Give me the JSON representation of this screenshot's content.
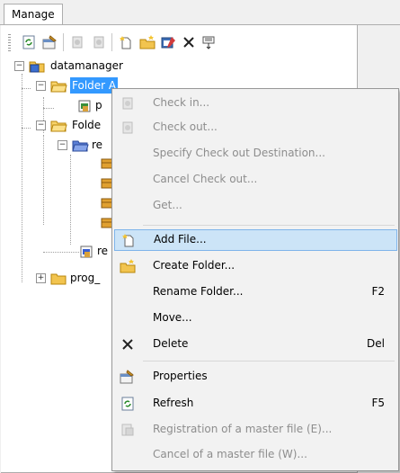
{
  "tab": {
    "label": "Manage"
  },
  "toolbar": {
    "buttons": [
      {
        "name": "refresh-icon"
      },
      {
        "name": "properties-icon"
      },
      {
        "name": "check-in-icon"
      },
      {
        "name": "check-out-icon"
      },
      {
        "name": "add-file-icon"
      },
      {
        "name": "create-folder-icon"
      },
      {
        "name": "rename-icon"
      },
      {
        "name": "delete-icon"
      },
      {
        "name": "settings-icon"
      }
    ]
  },
  "tree": {
    "root": "datamanager",
    "folder_a": "Folder A",
    "folder_a_child": "p",
    "folder_b": "Folde",
    "folder_b_child": "re",
    "folder_b_child2": "re",
    "prog": "prog_"
  },
  "menu": {
    "items": [
      {
        "label": "Check in...",
        "key": "",
        "enabled": false,
        "icon": "check-in-icon"
      },
      {
        "label": "Check out...",
        "key": "",
        "enabled": false,
        "icon": "check-out-icon"
      },
      {
        "label": "Specify Check out Destination...",
        "key": "",
        "enabled": false,
        "icon": ""
      },
      {
        "label": "Cancel Check out...",
        "key": "",
        "enabled": false,
        "icon": ""
      },
      {
        "label": "Get...",
        "key": "",
        "enabled": false,
        "icon": ""
      },
      {
        "label": "Add File...",
        "key": "",
        "enabled": true,
        "icon": "add-file-icon",
        "highlighted": true
      },
      {
        "label": "Create Folder...",
        "key": "",
        "enabled": true,
        "icon": "create-folder-icon"
      },
      {
        "label": "Rename Folder...",
        "key": "F2",
        "enabled": true,
        "icon": ""
      },
      {
        "label": "Move...",
        "key": "",
        "enabled": true,
        "icon": ""
      },
      {
        "label": "Delete",
        "key": "Del",
        "enabled": true,
        "icon": "delete-icon"
      },
      {
        "label": "Properties",
        "key": "",
        "enabled": true,
        "icon": "properties-icon"
      },
      {
        "label": "Refresh",
        "key": "F5",
        "enabled": true,
        "icon": "refresh-icon"
      },
      {
        "label": "Registration of a master file (E)...",
        "key": "",
        "enabled": false,
        "icon": "master-file-icon"
      },
      {
        "label": "Cancel of a master file (W)...",
        "key": "",
        "enabled": false,
        "icon": ""
      }
    ]
  }
}
